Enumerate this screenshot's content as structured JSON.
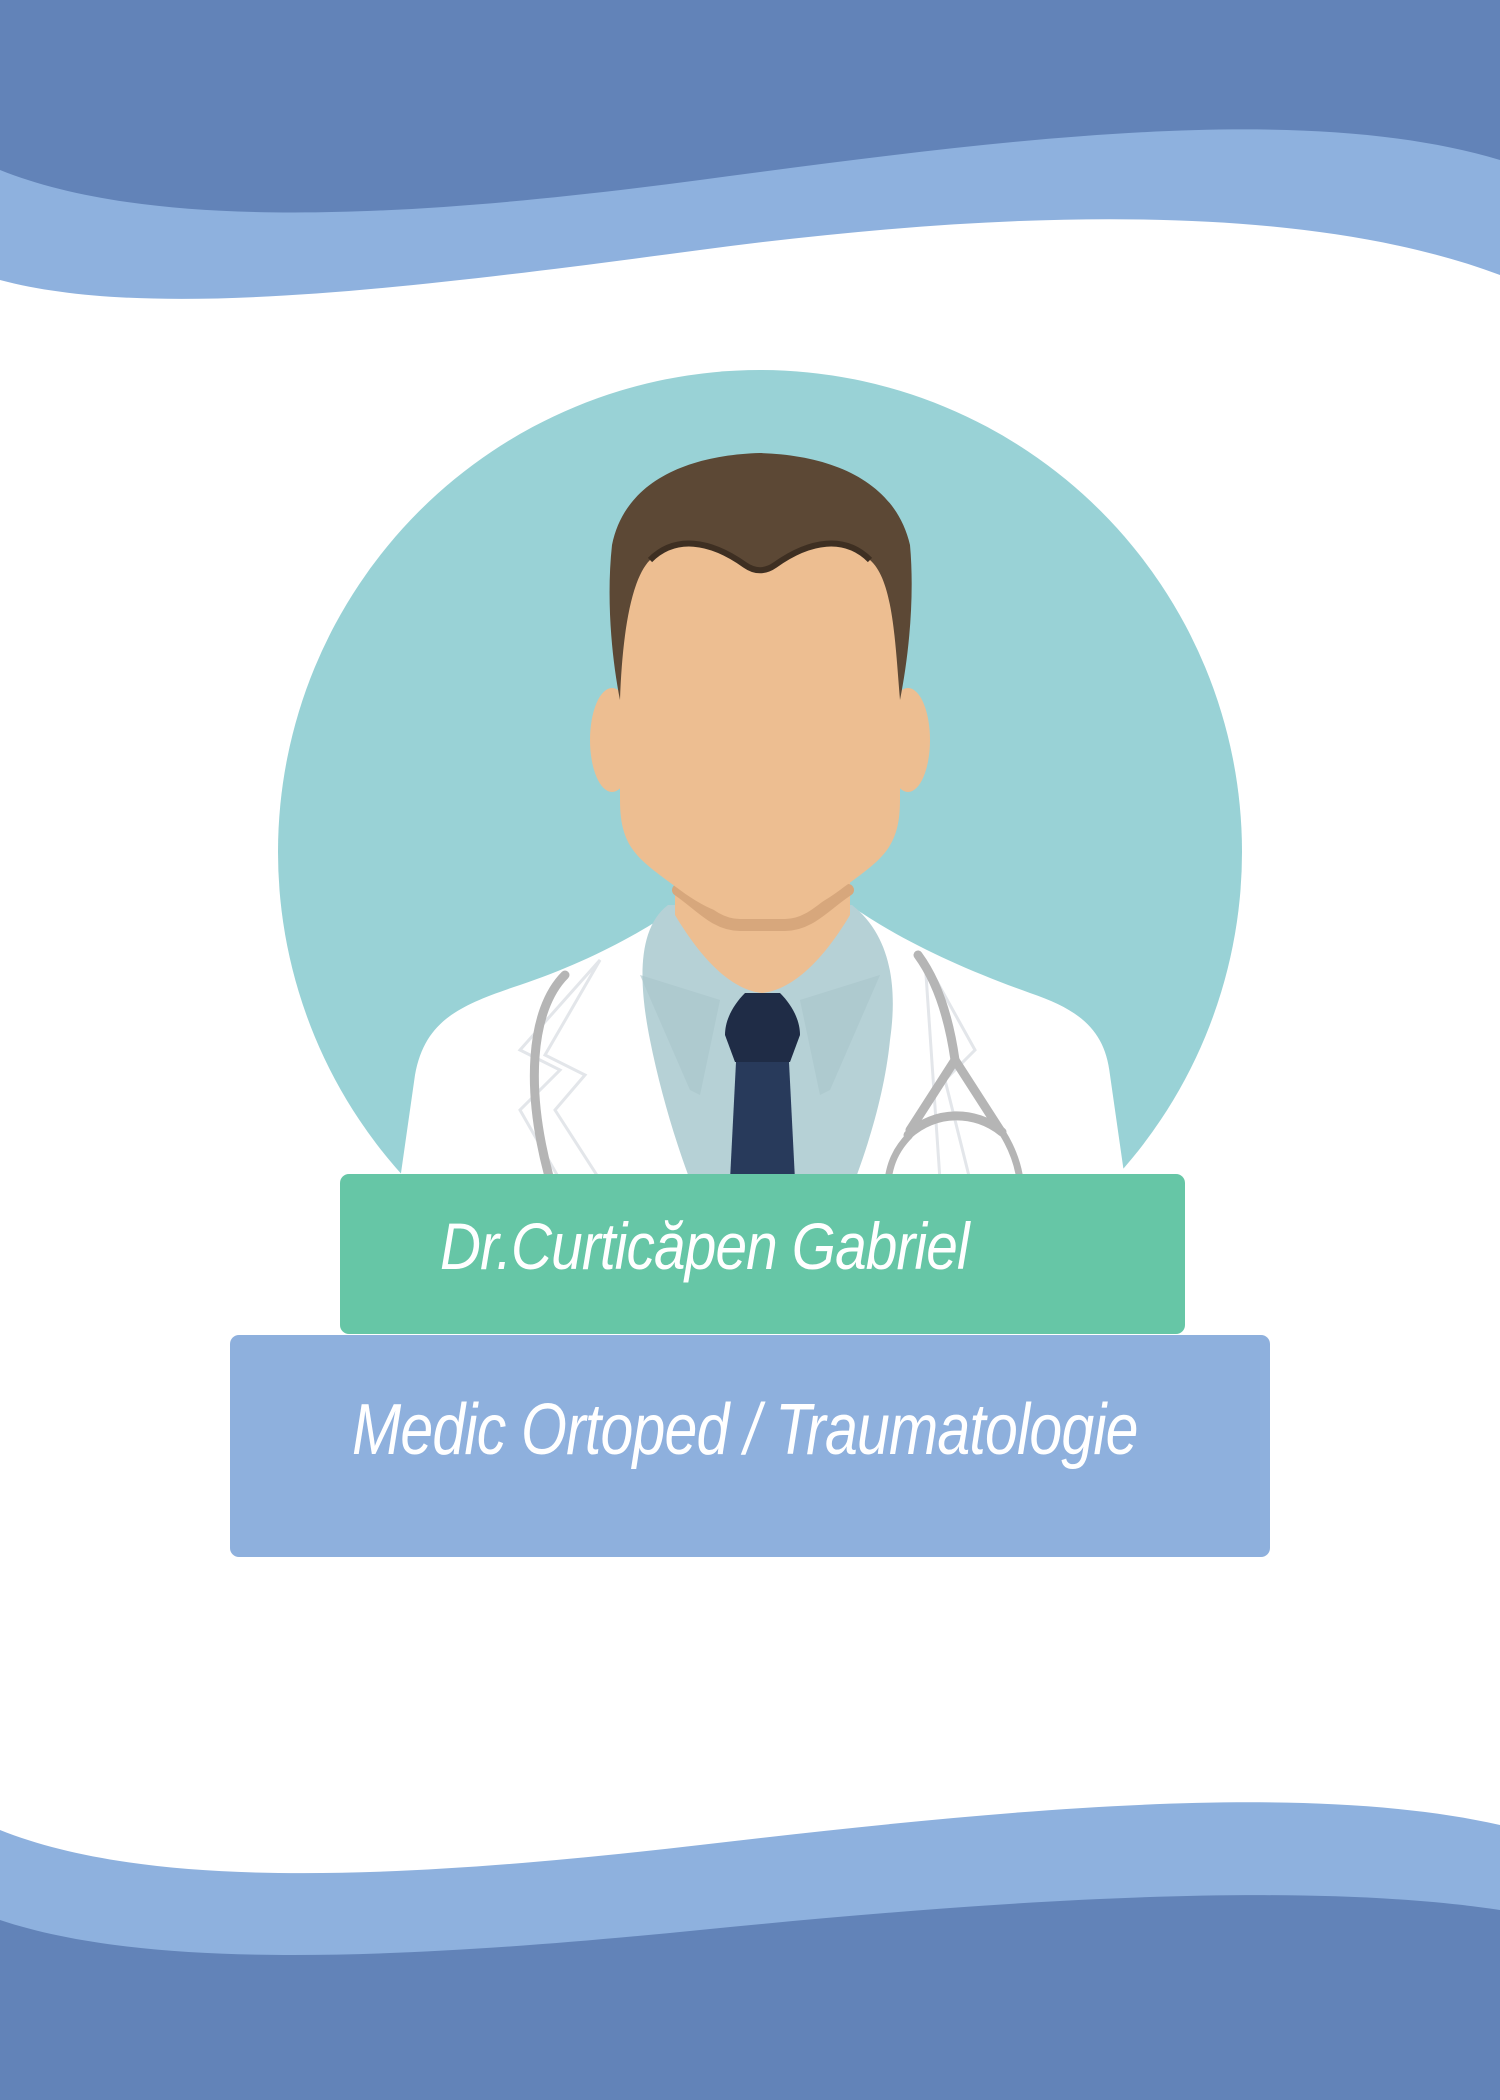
{
  "card": {
    "doctor_name": "Dr.Curticăpen Gabriel",
    "specialty": "Medic Ortoped / Traumatologie"
  },
  "colors": {
    "wave_dark": "#6283b8",
    "wave_light": "#8eb1de",
    "circle": "#99d2d6",
    "name_plate": "#66c6a6",
    "role_plate": "#8eb0dd"
  },
  "icons": [
    "doctor-avatar-illustration",
    "stethoscope-icon"
  ]
}
